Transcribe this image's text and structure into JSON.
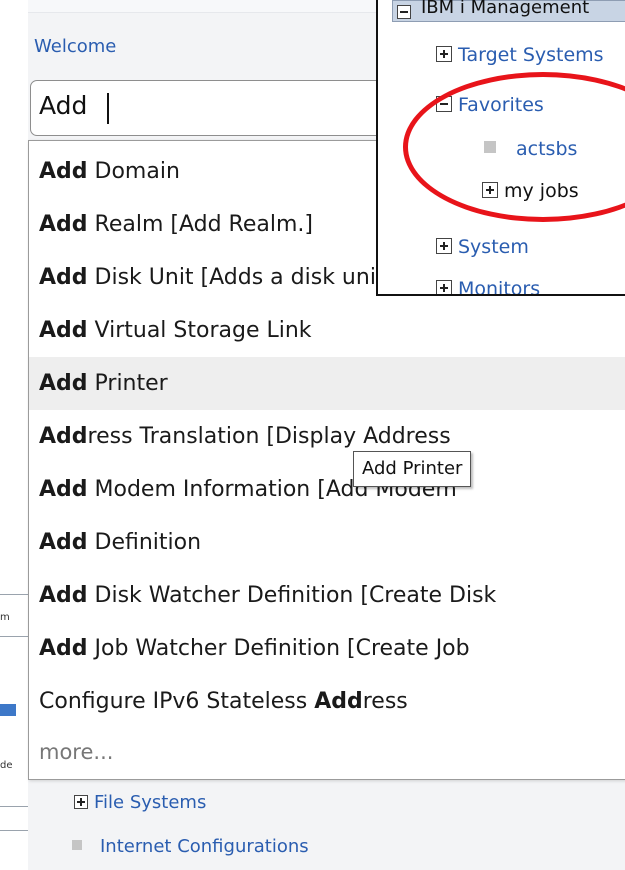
{
  "welcome_link": "Welcome",
  "search": {
    "value": "Add"
  },
  "suggestions": [
    {
      "match": "Add",
      "rest": " Domain"
    },
    {
      "match": "Add",
      "rest": " Realm [Add Realm.]"
    },
    {
      "match": "Add",
      "rest": " Disk Unit [Adds a disk unit]"
    },
    {
      "match": "Add",
      "rest": " Virtual Storage Link"
    },
    {
      "match": "Add",
      "rest": " Printer"
    },
    {
      "match": "Add",
      "rest": "ress Translation [Display Address"
    },
    {
      "match": "Add",
      "rest": " Modem Information [Add Modem"
    },
    {
      "match": "Add",
      "rest": " Definition"
    },
    {
      "match": "Add",
      "rest": " Disk Watcher Definition [Create Disk"
    },
    {
      "match": "Add",
      "rest": " Job Watcher Definition [Create Job"
    }
  ],
  "suggestion_last": {
    "prefix": "Configure IPv6 Stateless ",
    "match": "Add",
    "rest": "ress"
  },
  "more_label": "more...",
  "tooltip": "Add Printer",
  "bottom_tree": [
    {
      "label": "File Systems",
      "type": "expandable"
    },
    {
      "label": "Internet Configurations",
      "type": "leaf"
    }
  ],
  "inset": {
    "header": "IBM i Management",
    "rows": [
      {
        "label": "Target Systems",
        "type": "expandable"
      },
      {
        "label": "Favorites",
        "type": "expanded"
      },
      {
        "label": "actsbs",
        "type": "leaf"
      },
      {
        "label": "my jobs",
        "type": "expandable"
      },
      {
        "label": "System",
        "type": "expandable"
      },
      {
        "label": "Monitors",
        "type": "expandable"
      }
    ],
    "highlight_color": "#e8141a"
  },
  "left_strip": {
    "frag1": "m",
    "frag2": "de"
  },
  "colors": {
    "link": "#2a5db0",
    "hover": "#eeeeee",
    "accent": "#e8141a"
  }
}
